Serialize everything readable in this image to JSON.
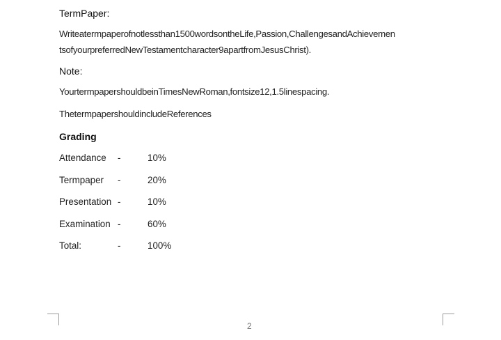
{
  "document": {
    "term_paper_heading": "TermPaper:",
    "instruction_line_1": "Writeatermpaperofnotlessthan1500wordsontheLife,Passion,ChallengesandAchievemen",
    "instruction_line_2": "tsofyourpreferredNewTestamentcharacter9apartfromJesusChrist).",
    "note_heading": "Note:",
    "note_line_1": "YourtermpapershouldbeinTimesNewRoman,fontsize12,1.5linespacing.",
    "note_line_2": "ThetermpapershouldincludeReferences",
    "grading_heading": "Grading",
    "grading": [
      {
        "label": "Attendance",
        "dash": "-",
        "value": "10%"
      },
      {
        "label": "Termpaper",
        "dash": "-",
        "value": "20%"
      },
      {
        "label": "Presentation",
        "dash": "-",
        "value": "10%"
      },
      {
        "label": "Examination",
        "dash": "-",
        "value": "60%"
      },
      {
        "label": "Total:",
        "dash": "-",
        "value": "100%"
      }
    ],
    "page_number": "2"
  }
}
